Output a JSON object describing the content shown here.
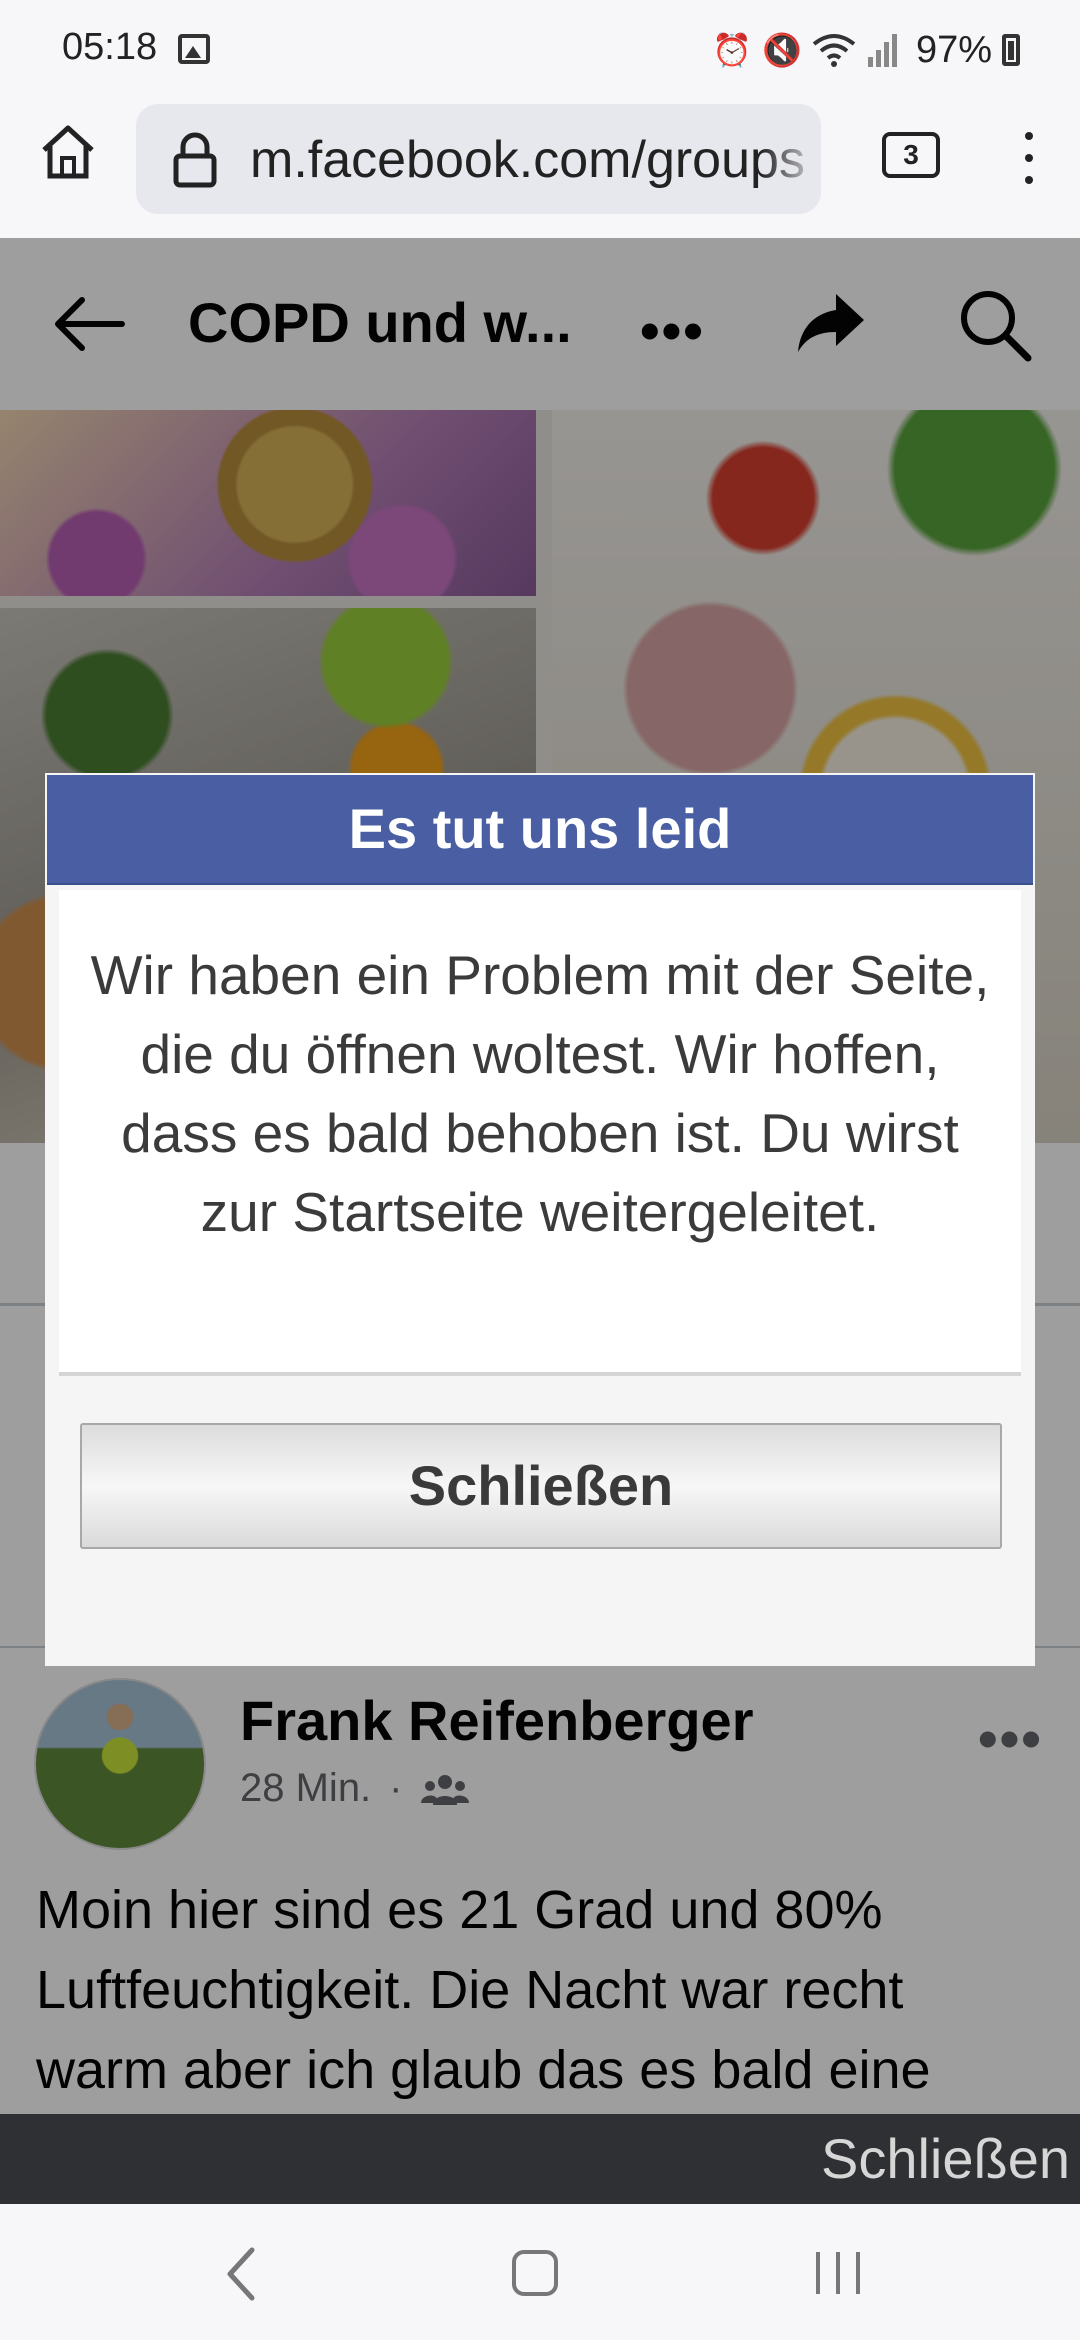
{
  "status_bar": {
    "time": "05:18",
    "battery": "97%",
    "icons": [
      "gallery-icon",
      "alarm-icon",
      "mute-icon",
      "wifi-icon",
      "signal-icon",
      "battery-icon"
    ]
  },
  "browser": {
    "url": "m.facebook.com/groups",
    "tab_count": "3"
  },
  "fb_header": {
    "group_title": "COPD und w...",
    "more_label": "•••"
  },
  "post": {
    "author": "Frank Reifenberger",
    "time": "28 Min.",
    "separator": "·",
    "options_label": "•••",
    "text": "Moin hier sind es 21 Grad und 80% Luftfeuchtigkeit. Die Nacht war recht warm aber ich glaub das es bald eine"
  },
  "dialog": {
    "title": "Es tut uns leid",
    "message": "Wir haben ein Problem mit der Seite, die du öffnen woltest. Wir hoffen, dass es bald behoben ist. Du wirst zur Startseite weitergeleitet.",
    "close_label": "Schließen"
  },
  "snackbar": {
    "action_label": "Schließen"
  },
  "colors": {
    "dialog_header": "#4a5fa3",
    "overlay": "rgba(0,0,0,0.38)",
    "snackbar": "#2f3033"
  }
}
